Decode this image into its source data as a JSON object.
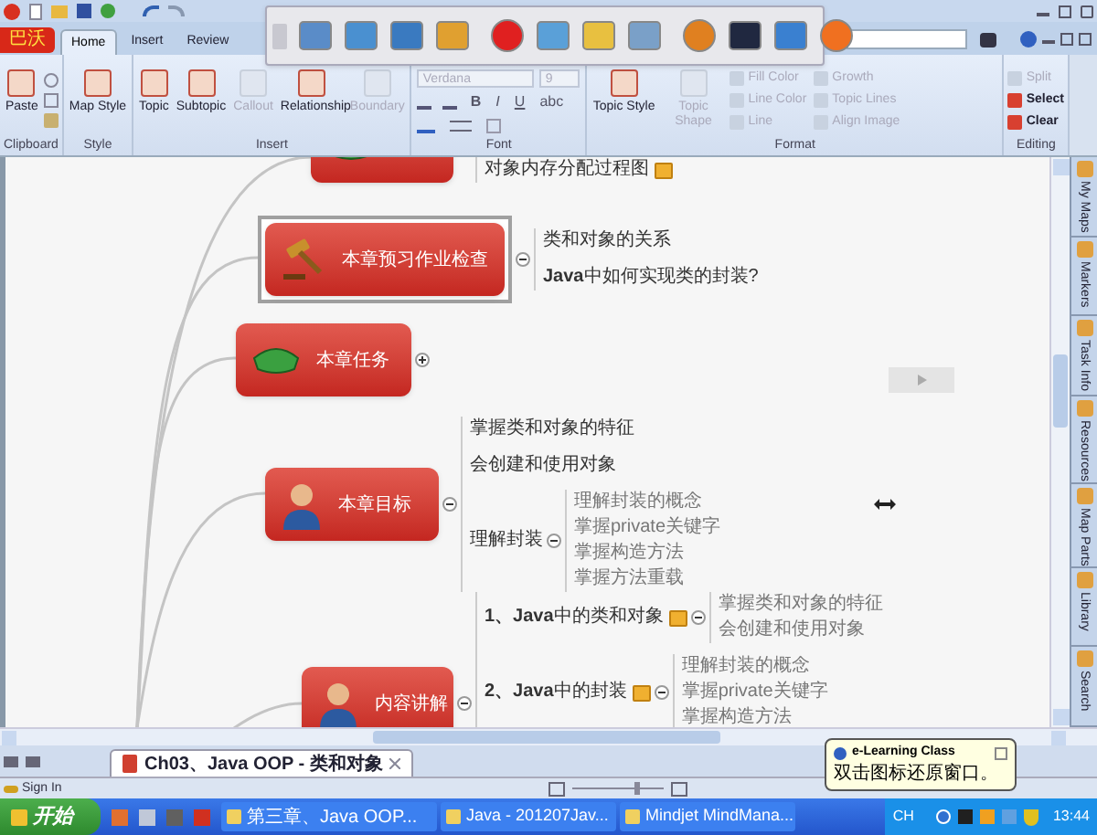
{
  "ribbon": {
    "app_button": "巴沃",
    "tabs": [
      {
        "label": "Home",
        "selected": true
      },
      {
        "label": "Insert",
        "selected": false
      },
      {
        "label": "Review",
        "selected": false
      }
    ],
    "groups": [
      {
        "label": "Clipboard",
        "kind": "buttons",
        "buttons": [
          {
            "label": "Paste",
            "kind": "large",
            "disabled": false
          }
        ]
      },
      {
        "label": "Style",
        "kind": "buttons",
        "buttons": [
          {
            "label": "Map Style",
            "kind": "large",
            "disabled": false
          }
        ]
      },
      {
        "label": "Insert",
        "kind": "buttons",
        "buttons": [
          {
            "label": "Topic",
            "kind": "large",
            "disabled": false
          },
          {
            "label": "Subtopic",
            "kind": "large",
            "disabled": false
          },
          {
            "label": "Callout",
            "kind": "large",
            "disabled": true
          },
          {
            "label": "Relationship",
            "kind": "large",
            "disabled": false
          },
          {
            "label": "Boundary",
            "kind": "large",
            "disabled": true
          }
        ]
      },
      {
        "label": "Font",
        "kind": "font",
        "font_name": "Verdana",
        "font_size": "9",
        "styles": [
          "B",
          "I",
          "U",
          "abc"
        ]
      },
      {
        "label": "Format",
        "kind": "buttons",
        "buttons": [
          {
            "label": "Topic Style",
            "kind": "large",
            "disabled": false
          },
          {
            "label": "Topic Shape",
            "kind": "large",
            "disabled": true
          },
          {
            "label": "Fill Color",
            "kind": "small",
            "disabled": true
          },
          {
            "label": "Line Color",
            "kind": "small",
            "disabled": true
          },
          {
            "label": "Line",
            "kind": "small",
            "disabled": true
          },
          {
            "label": "Growth",
            "kind": "small",
            "disabled": true
          },
          {
            "label": "Topic Lines",
            "kind": "small",
            "disabled": true
          },
          {
            "label": "Align Image",
            "kind": "small",
            "disabled": true
          }
        ]
      },
      {
        "label": "Editing",
        "kind": "buttons",
        "buttons": [
          {
            "label": "Split",
            "kind": "small",
            "disabled": true
          },
          {
            "label": "Select",
            "kind": "small",
            "disabled": false
          },
          {
            "label": "Clear",
            "kind": "small",
            "disabled": false
          }
        ]
      }
    ]
  },
  "map": {
    "branches": [
      {
        "kind": "cap",
        "selected": false,
        "children": [
          {
            "label": "对象内存分配过程图",
            "attachment": true
          }
        ]
      },
      {
        "label": "本章预习作业检查",
        "kind": "gavel",
        "selected": true,
        "expanded": true,
        "children": [
          {
            "label": "类和对象的关系",
            "attachment": false
          },
          {
            "label": "**Java**中如何实现类的封装?",
            "attachment": false
          }
        ]
      },
      {
        "label": "本章任务",
        "kind": "cap",
        "selected": false,
        "expanded": false
      },
      {
        "label": "本章目标",
        "kind": "person",
        "selected": false,
        "expanded": true,
        "children": [
          {
            "label": "掌握类和对象的特征",
            "attachment": false
          },
          {
            "label": "会创建和使用对象",
            "attachment": false
          },
          {
            "label": "理解封装",
            "attachment": false,
            "expanded": true,
            "children": [
              {
                "label": "理解封装的概念"
              },
              {
                "label": "掌握private关键字"
              },
              {
                "label": "掌握构造方法"
              },
              {
                "label": "掌握方法重载"
              }
            ]
          }
        ]
      },
      {
        "label": "内容讲解",
        "kind": "person",
        "selected": false,
        "expanded": true,
        "children": [
          {
            "label": "**1、Java**中的类和对象",
            "attachment": true,
            "expanded": true,
            "children": [
              {
                "label": "掌握类和对象的特征"
              },
              {
                "label": "会创建和使用对象"
              }
            ]
          },
          {
            "label": "**2、Java**中的封装",
            "attachment": true,
            "expanded": true,
            "children": [
              {
                "label": "理解封装的概念"
              },
              {
                "label": "掌握private关键字"
              },
              {
                "label": "掌握构造方法"
              }
            ]
          }
        ]
      }
    ]
  },
  "side_panel": {
    "tabs": [
      "My Maps",
      "Markers",
      "Task Info",
      "Resources",
      "Map Parts",
      "Library",
      "Search"
    ]
  },
  "doc_tabs": [
    {
      "label": "Ch03、Java OOP - 类和对象",
      "selected": true
    }
  ],
  "status_bar": {
    "sign_in": "Sign In",
    "zoom": {
      "level": 0.72
    }
  },
  "taskbar": {
    "start": "开始",
    "tasks": [
      "第三章、Java OOP...",
      "Java - 201207Jav...",
      "Mindjet MindMana..."
    ],
    "language": "CH",
    "clock": "13:44"
  },
  "balloon": {
    "title": "e-Learning Class",
    "text": "双击图标还原窗口。"
  }
}
